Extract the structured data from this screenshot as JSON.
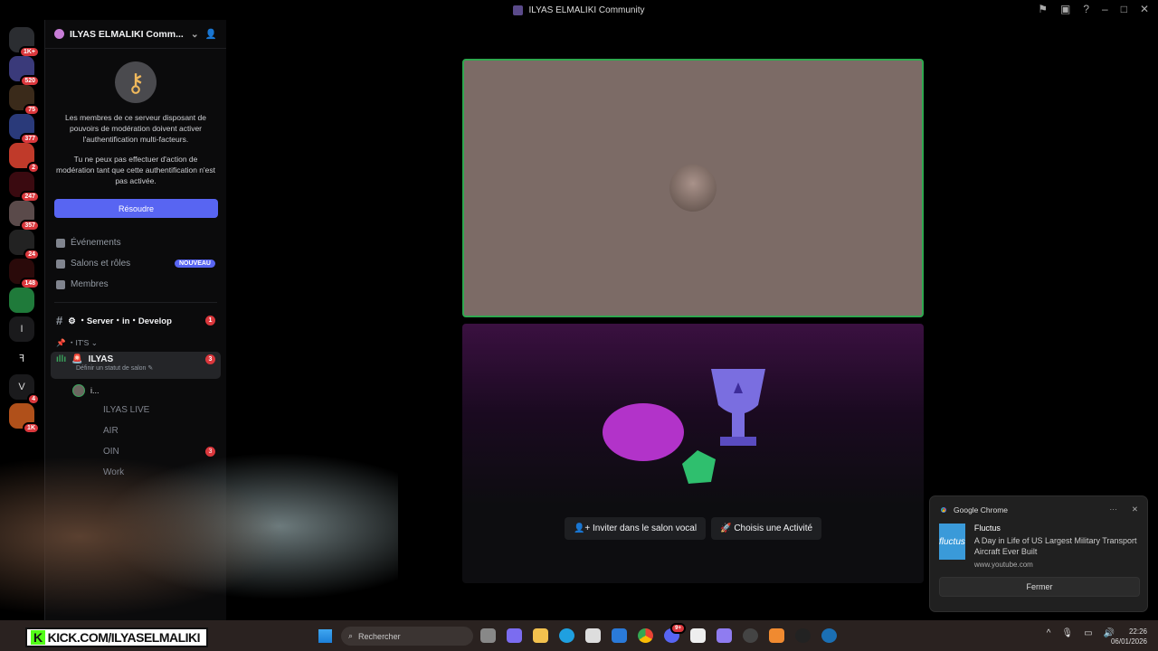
{
  "window": {
    "title": "ILYAS ELMALIKI Community",
    "icons": [
      "flag-icon",
      "inbox-icon",
      "help-icon",
      "minimize-icon",
      "maximize-icon",
      "close-icon"
    ]
  },
  "rail": {
    "servers": [
      {
        "badge": "1K+",
        "icon": "discord-home-icon"
      },
      {
        "badge": "520"
      },
      {
        "badge": "75"
      },
      {
        "badge": "377"
      },
      {
        "badge": "2"
      },
      {
        "badge": "247"
      },
      {
        "badge": "357"
      },
      {
        "badge": "24"
      },
      {
        "badge": "148"
      },
      {
        "badge": ""
      },
      {
        "label": "I",
        "badge": ""
      },
      {
        "label": "ꟻ",
        "badge": ""
      },
      {
        "label": "V",
        "badge": "4"
      },
      {
        "badge": "1K"
      }
    ]
  },
  "sidebar": {
    "server_name": "ILYAS ELMALIKI Comm...",
    "mfa_text_1": "Les membres de ce serveur disposant de pouvoirs de modération doivent activer l'authentification multi-facteurs.",
    "mfa_text_2": "Tu ne peux pas effectuer d'action de modération tant que cette authentification n'est pas activée.",
    "resolve_label": "Résoudre",
    "nav": [
      {
        "label": "Événements"
      },
      {
        "label": "Salons et rôles",
        "badge": "NOUVEAU"
      },
      {
        "label": "Membres"
      }
    ],
    "channel": {
      "label": "⚙ ・Server・in・Develop",
      "badge": "1"
    },
    "category": "・IT'S",
    "voice": {
      "label": "ILYAS",
      "status": "Définir un statut de salon",
      "badge": "3"
    },
    "voice_user": "i...",
    "channels": [
      {
        "label": "ILYAS LIVE"
      },
      {
        "label": "AIR"
      },
      {
        "label": "OIN",
        "badge": "3"
      },
      {
        "label": "Work"
      }
    ]
  },
  "activity": {
    "invite_label": "Inviter dans le salon vocal",
    "activity_label": "Choisis une Activité"
  },
  "overlay": {
    "kick_text": "KICK.COM/ILYASELMALIKI",
    "kick_logo": "K"
  },
  "notification": {
    "app": "Google Chrome",
    "title": "Fluctus",
    "message": "A Day in Life of US Largest Military Transport Aircraft Ever Built",
    "source": "www.youtube.com",
    "thumb_text": "fluctus",
    "close_label": "Fermer"
  },
  "taskbar": {
    "search_placeholder": "Rechercher",
    "time": "22:26",
    "date": "06/01/2026",
    "discord_badge": "9+"
  }
}
